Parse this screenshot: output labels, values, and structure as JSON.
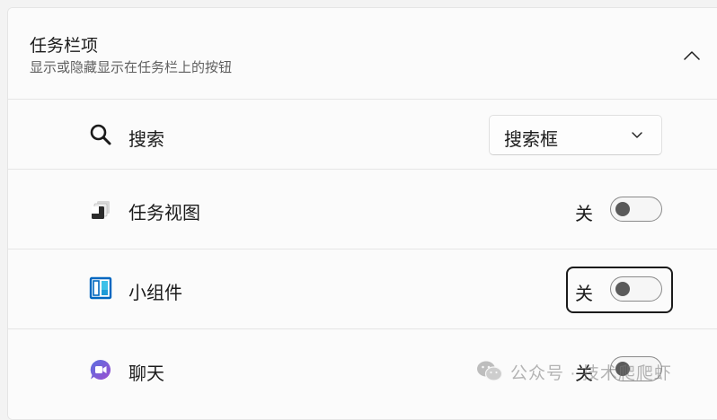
{
  "section": {
    "title": "任务栏项",
    "subtitle": "显示或隐藏显示在任务栏上的按钮",
    "collapse_icon": "chevron-up-icon"
  },
  "rows": [
    {
      "label": "搜索",
      "icon": "search-icon",
      "control": "dropdown",
      "value": "搜索框"
    },
    {
      "label": "任务视图",
      "icon": "task-view-icon",
      "control": "toggle",
      "state": "关",
      "on": false
    },
    {
      "label": "小组件",
      "icon": "widgets-icon",
      "control": "toggle",
      "state": "关",
      "on": false,
      "focused": true
    },
    {
      "label": "聊天",
      "icon": "chat-icon",
      "control": "toggle",
      "state": "关",
      "on": false
    }
  ],
  "watermark": {
    "text": "公众号 · 技术爬爬虾",
    "icon": "wechat-icon"
  },
  "colors": {
    "background": "#f3f3f3",
    "card": "#fbfbfb",
    "divider": "#e5e5e5",
    "text_primary": "#1b1b1b",
    "text_secondary": "#5f5f5f",
    "widgets_blue": "#0067c0",
    "widgets_cyan": "#3ec1e8",
    "chat_purple": "#7b5cd6"
  }
}
